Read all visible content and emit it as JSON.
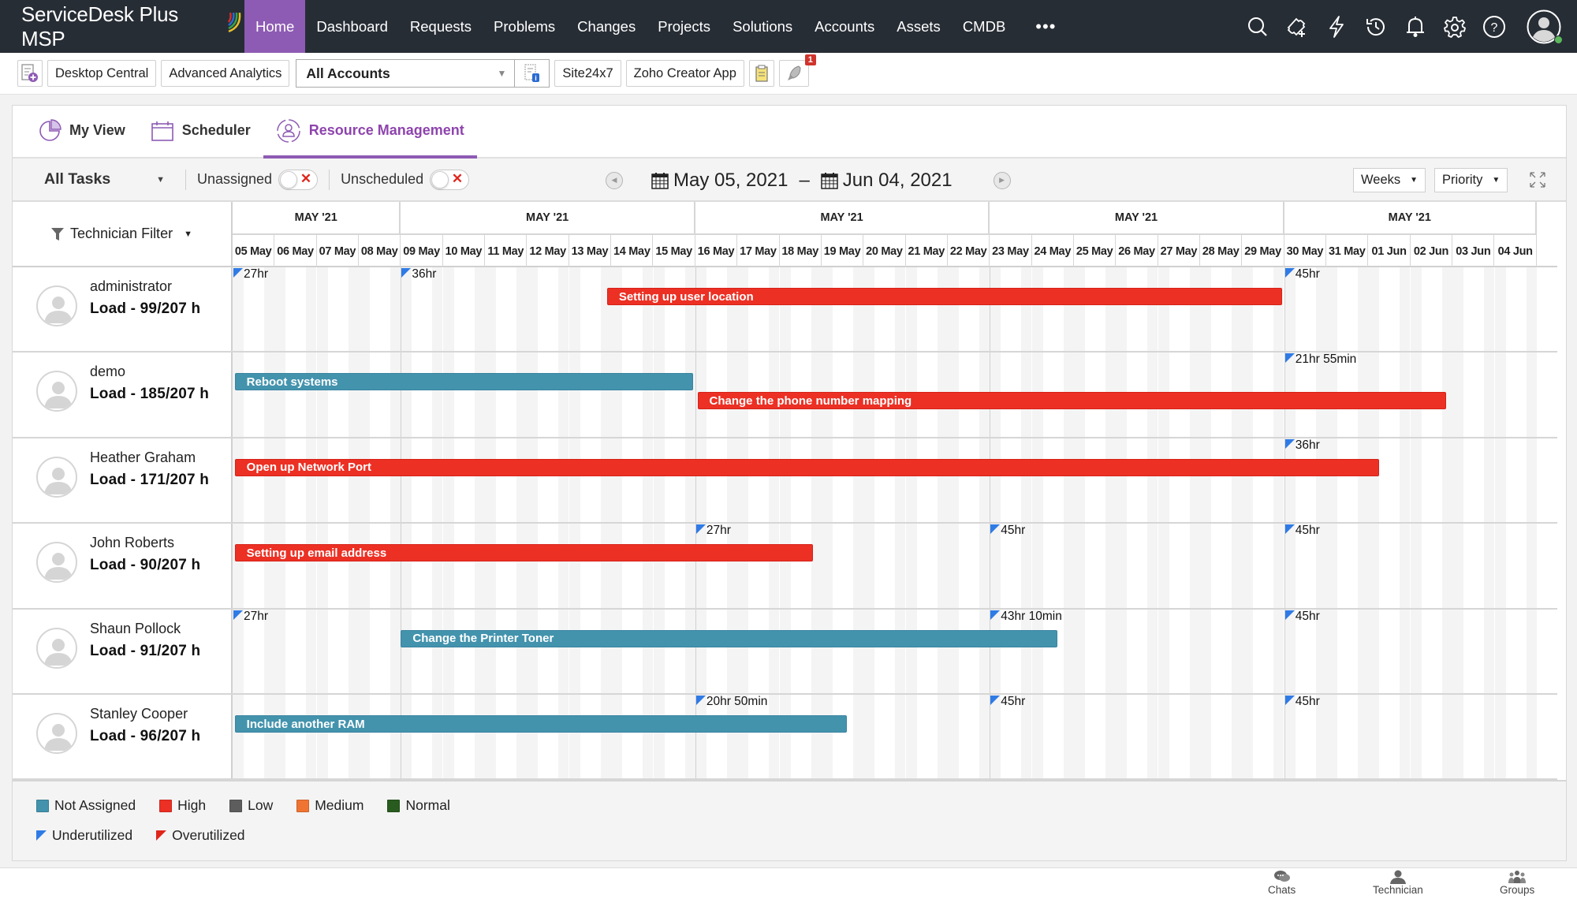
{
  "app": {
    "brand": "ServiceDesk Plus MSP",
    "nav": [
      "Home",
      "Dashboard",
      "Requests",
      "Problems",
      "Changes",
      "Projects",
      "Solutions",
      "Accounts",
      "Assets",
      "CMDB"
    ],
    "active_nav": "Home",
    "more_label": "•••",
    "nav_icons": [
      "search-icon",
      "add-ticket-icon",
      "quick-actions-icon",
      "history-icon",
      "notifications-icon",
      "settings-icon",
      "help-icon",
      "user-avatar-icon"
    ]
  },
  "apps_bar": {
    "buttons": [
      "Desktop Central",
      "Advanced Analytics"
    ],
    "account_select": "All Accounts",
    "buttons_right": [
      "Site24x7",
      "Zoho Creator App"
    ],
    "notification_badge": "1"
  },
  "tabs": [
    {
      "label": "My View",
      "icon": "pie-chart-icon"
    },
    {
      "label": "Scheduler",
      "icon": "calendar-icon"
    },
    {
      "label": "Resource Management",
      "icon": "resource-icon",
      "active": true
    }
  ],
  "toolbar": {
    "task_filter": "All Tasks",
    "unassigned_label": "Unassigned",
    "unassigned_on": false,
    "unscheduled_label": "Unscheduled",
    "unscheduled_on": false,
    "date_from": "May 05, 2021",
    "date_separator": "–",
    "date_to": "Jun 04, 2021",
    "view_select": "Weeks",
    "group_select": "Priority"
  },
  "gantt": {
    "technician_filter_label": "Technician Filter",
    "weeks": [
      {
        "label": "MAY '21",
        "days": 4
      },
      {
        "label": "MAY '21",
        "days": 7
      },
      {
        "label": "MAY '21",
        "days": 7
      },
      {
        "label": "MAY '21",
        "days": 7
      },
      {
        "label": "MAY '21",
        "days": 6
      }
    ],
    "days": [
      "05 May",
      "06 May",
      "07 May",
      "08 May",
      "09 May",
      "10 May",
      "11 May",
      "12 May",
      "13 May",
      "14 May",
      "15 May",
      "16 May",
      "17 May",
      "18 May",
      "19 May",
      "20 May",
      "21 May",
      "22 May",
      "23 May",
      "24 May",
      "25 May",
      "26 May",
      "27 May",
      "28 May",
      "29 May",
      "30 May",
      "31 May",
      "01 Jun",
      "02 Jun",
      "03 Jun",
      "04 Jun"
    ],
    "technicians": [
      {
        "name": "administrator",
        "load": "Load - 99/207 h",
        "utilization": [
          {
            "week": 0,
            "label": "27hr",
            "type": "under"
          },
          {
            "week": 1,
            "label": "36hr",
            "type": "under"
          },
          {
            "week": 4,
            "label": "45hr",
            "type": "under"
          }
        ],
        "tasks": [
          {
            "title": "Setting up user location",
            "start_day": 8.9,
            "end_day": 24.95,
            "priority": "High",
            "lane": 0
          }
        ]
      },
      {
        "name": "demo",
        "load": "Load - 185/207 h",
        "utilization": [
          {
            "week": 4,
            "label": "21hr 55min",
            "type": "under"
          }
        ],
        "tasks": [
          {
            "title": "Reboot systems",
            "start_day": 0.05,
            "end_day": 10.95,
            "priority": "Not Assigned",
            "lane": 0
          },
          {
            "title": "Change the phone number mapping",
            "start_day": 11.05,
            "end_day": 28.85,
            "priority": "High",
            "lane": 1
          }
        ]
      },
      {
        "name": "Heather Graham",
        "load": "Load - 171/207 h",
        "utilization": [
          {
            "week": 4,
            "label": "36hr",
            "type": "under"
          }
        ],
        "tasks": [
          {
            "title": "Open up Network Port",
            "start_day": 0.05,
            "end_day": 27.25,
            "priority": "High",
            "lane": 0
          }
        ]
      },
      {
        "name": "John Roberts",
        "load": "Load - 90/207 h",
        "utilization": [
          {
            "week": 2,
            "label": "27hr",
            "type": "under"
          },
          {
            "week": 3,
            "label": "45hr",
            "type": "under"
          },
          {
            "week": 4,
            "label": "45hr",
            "type": "under"
          }
        ],
        "tasks": [
          {
            "title": "Setting up email address",
            "start_day": 0.05,
            "end_day": 13.8,
            "priority": "High",
            "lane": 0
          }
        ]
      },
      {
        "name": "Shaun Pollock",
        "load": "Load - 91/207 h",
        "utilization": [
          {
            "week": 0,
            "label": "27hr",
            "type": "under"
          },
          {
            "week": 3,
            "label": "43hr 10min",
            "type": "under"
          },
          {
            "week": 4,
            "label": "45hr",
            "type": "under"
          }
        ],
        "tasks": [
          {
            "title": "Change the Printer Toner",
            "start_day": 4.0,
            "end_day": 19.6,
            "priority": "Not Assigned",
            "lane": 0
          }
        ]
      },
      {
        "name": "Stanley Cooper",
        "load": "Load - 96/207 h",
        "utilization": [
          {
            "week": 2,
            "label": "20hr 50min",
            "type": "under"
          },
          {
            "week": 3,
            "label": "45hr",
            "type": "under"
          },
          {
            "week": 4,
            "label": "45hr",
            "type": "under"
          }
        ],
        "tasks": [
          {
            "title": "Include another RAM",
            "start_day": 0.05,
            "end_day": 14.6,
            "priority": "Not Assigned",
            "lane": 0
          }
        ]
      }
    ]
  },
  "legend": {
    "priorities": [
      {
        "label": "Not Assigned",
        "color": "#4393ad"
      },
      {
        "label": "High",
        "color": "#ec3024"
      },
      {
        "label": "Low",
        "color": "#5d5d5d"
      },
      {
        "label": "Medium",
        "color": "#f07431"
      },
      {
        "label": "Normal",
        "color": "#295b1f"
      }
    ],
    "utilization": [
      {
        "label": "Underutilized",
        "color": "#2f7be6"
      },
      {
        "label": "Overutilized",
        "color": "#e0251b"
      }
    ]
  },
  "bottom_bar": [
    "Chats",
    "Technician",
    "Groups"
  ],
  "colors": {
    "topnav_bg": "#272d35",
    "accent": "#8e5bb4"
  }
}
